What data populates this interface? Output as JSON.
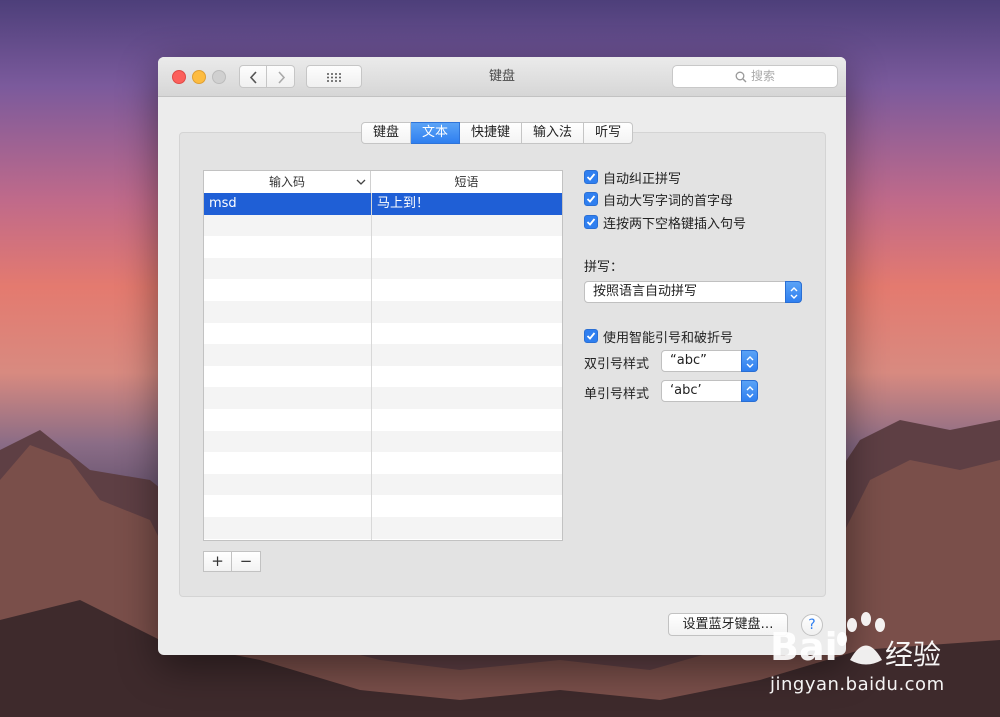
{
  "window": {
    "title": "键盘"
  },
  "search": {
    "placeholder": "搜索"
  },
  "tabs": [
    {
      "label": "键盘",
      "active": false
    },
    {
      "label": "文本",
      "active": true
    },
    {
      "label": "快捷键",
      "active": false
    },
    {
      "label": "输入法",
      "active": false
    },
    {
      "label": "听写",
      "active": false
    }
  ],
  "table": {
    "columns": [
      "输入码",
      "短语"
    ],
    "rows": [
      {
        "code": "msd",
        "phrase": "马上到！",
        "selected": true
      }
    ]
  },
  "options": {
    "auto_correct": "自动纠正拼写",
    "auto_capitalize": "自动大写字词的首字母",
    "double_space_period": "连按两下空格键插入句号",
    "spelling_label": "拼写：",
    "spelling_value": "按照语言自动拼写",
    "smart_quotes": "使用智能引号和破折号",
    "double_quote_label": "双引号样式",
    "double_quote_value": "“abc”",
    "single_quote_label": "单引号样式",
    "single_quote_value": "‘abc’"
  },
  "buttons": {
    "add": "+",
    "remove": "−",
    "bluetooth": "设置蓝牙键盘…",
    "help": "?"
  },
  "watermark": {
    "brand_left": "Bai",
    "brand_right": "经验",
    "url": "jingyan.baidu.com"
  },
  "colors": {
    "accent": "#2f7ff0",
    "selection": "#1f5fd6"
  }
}
